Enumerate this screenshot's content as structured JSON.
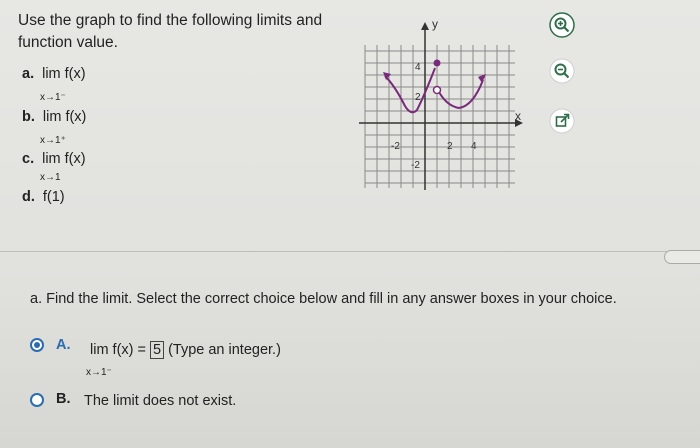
{
  "problem": {
    "instructions": "Use the graph to find the following limits and function value.",
    "parts": [
      {
        "letter": "a.",
        "expr": "lim  f(x)",
        "sub": "x→1⁻"
      },
      {
        "letter": "b.",
        "expr": "lim  f(x)",
        "sub": "x→1⁺"
      },
      {
        "letter": "c.",
        "expr": "lim  f(x)",
        "sub": "x→1"
      },
      {
        "letter": "d.",
        "expr": "f(1)",
        "sub": ""
      }
    ]
  },
  "graph": {
    "y_axis_label": "y",
    "x_axis_label": "x",
    "x_ticks": [
      "-2",
      "2",
      "4"
    ],
    "y_ticks": [
      "4",
      "2",
      "-2"
    ],
    "curve_color": "#7a2a7a",
    "points": [
      {
        "x": 1,
        "y": 5,
        "filled": true
      },
      {
        "x": 1,
        "y": 2,
        "filled": false
      }
    ]
  },
  "tools": {
    "zoom_in": "zoom-in-icon",
    "zoom_out": "zoom-out-icon",
    "popout": "external-link-icon"
  },
  "answer": {
    "question": "a. Find the limit. Select the correct choice below and fill in any answer boxes in your choice.",
    "choiceA": {
      "letter": "A.",
      "prefix": "lim  f(x) =",
      "value": "5",
      "suffix": "(Type an integer.)",
      "sub": "x→1⁻"
    },
    "choiceB": {
      "letter": "B.",
      "text": "The limit does not exist."
    },
    "selected": "A",
    "accent_color": "#2b6cb0"
  }
}
